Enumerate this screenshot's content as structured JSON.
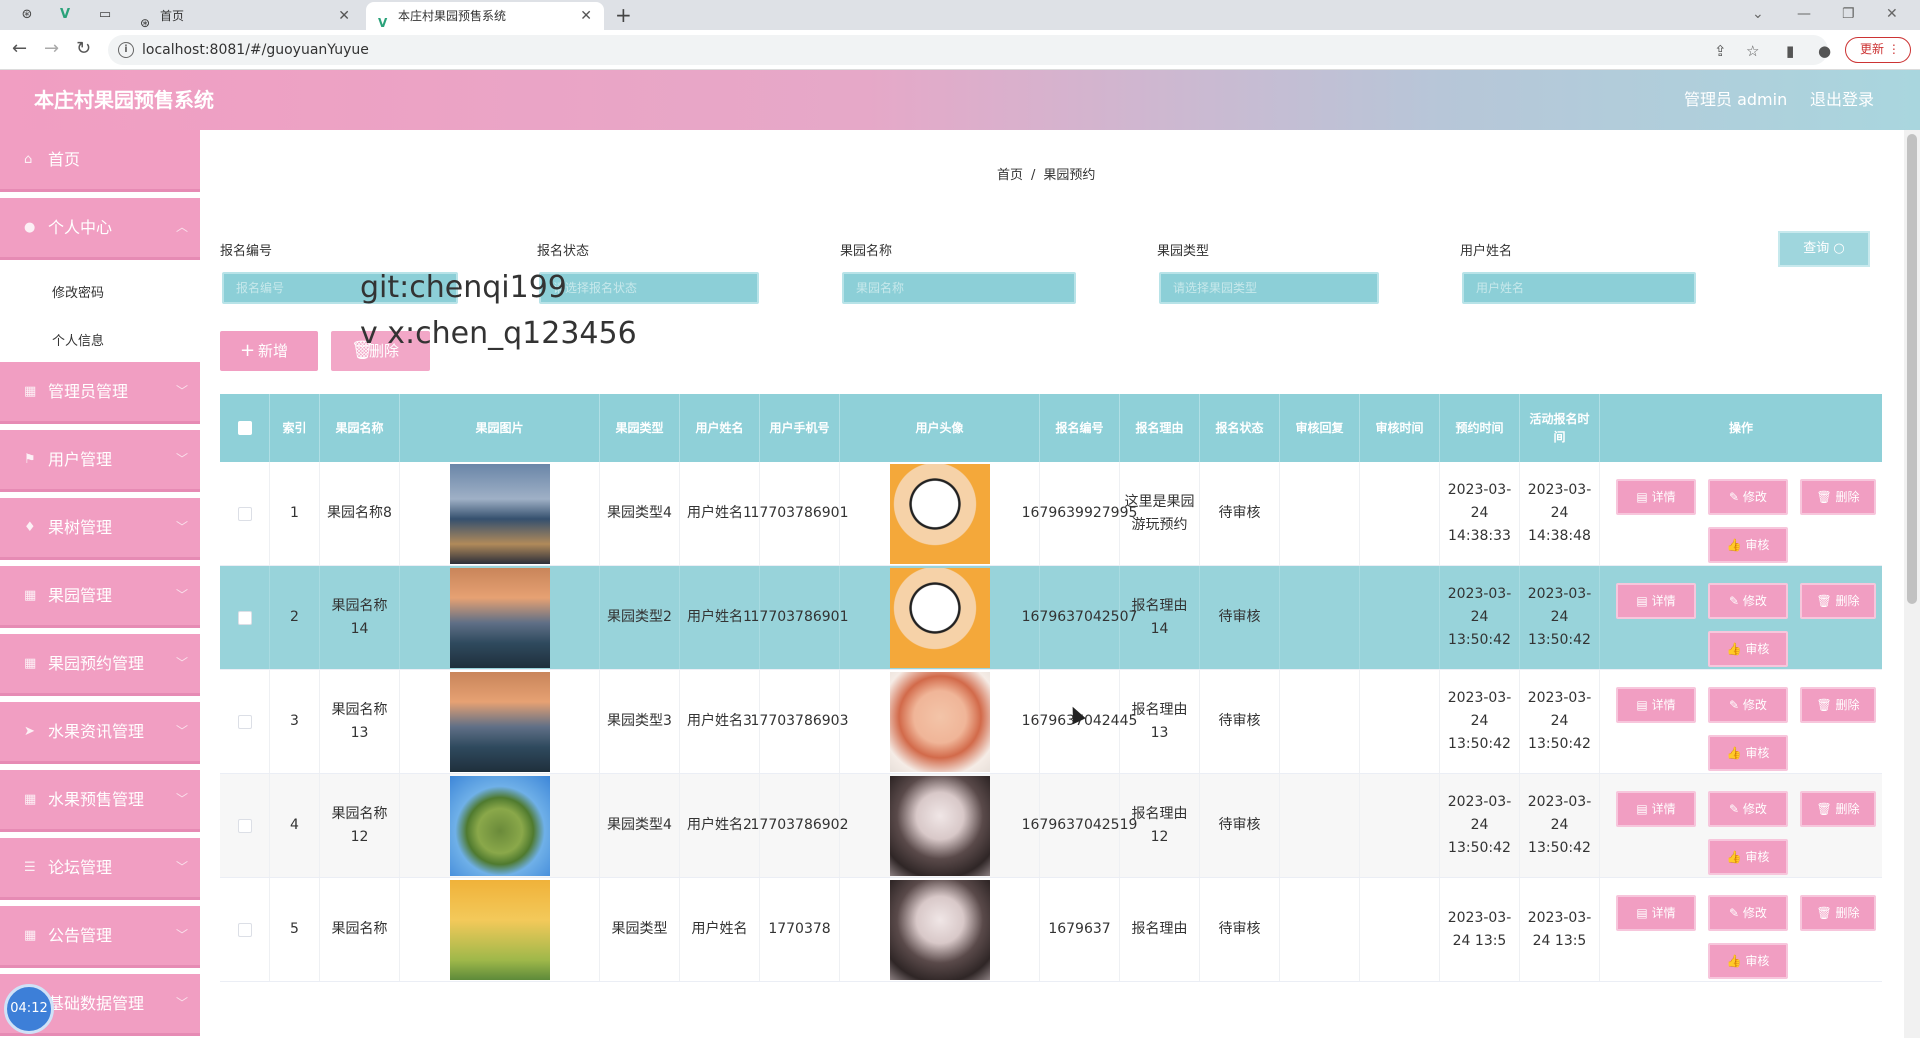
{
  "browser": {
    "tabs": [
      {
        "title": "首页",
        "active": false
      },
      {
        "title": "本庄村果园预售系统",
        "active": true
      }
    ],
    "url": "localhost:8081/#/guoyuanYuyue",
    "update_label": "更新"
  },
  "app": {
    "title": "本庄村果园预售系统",
    "admin_label": "管理员 admin",
    "logout_label": "退出登录"
  },
  "sidebar": {
    "items": [
      {
        "label": "首页",
        "icon": "home-icon"
      },
      {
        "label": "个人中心",
        "icon": "user-icon"
      },
      {
        "label": "修改密码",
        "sub": true
      },
      {
        "label": "个人信息",
        "sub": true
      },
      {
        "label": "管理员管理",
        "icon": "grid-icon"
      },
      {
        "label": "用户管理",
        "icon": "flag-icon"
      },
      {
        "label": "果树管理",
        "icon": "bulb-icon"
      },
      {
        "label": "果园管理",
        "icon": "grid-icon"
      },
      {
        "label": "果园预约管理",
        "icon": "grid-icon"
      },
      {
        "label": "水果资讯管理",
        "icon": "send-icon"
      },
      {
        "label": "水果预售管理",
        "icon": "grid-icon"
      },
      {
        "label": "论坛管理",
        "icon": "list-icon"
      },
      {
        "label": "公告管理",
        "icon": "grid-icon"
      },
      {
        "label": "基础数据管理",
        "icon": "grid-icon"
      }
    ]
  },
  "breadcrumb": [
    "首页",
    "/",
    "果园预约"
  ],
  "filters": [
    {
      "label": "报名编号",
      "placeholder": "报名编号"
    },
    {
      "label": "报名状态",
      "placeholder": "请选择报名状态"
    },
    {
      "label": "果园名称",
      "placeholder": "果园名称"
    },
    {
      "label": "果园类型",
      "placeholder": "请选择果园类型"
    },
    {
      "label": "用户姓名",
      "placeholder": "用户姓名"
    }
  ],
  "search_label": "查询",
  "add_label": "新增",
  "delete_label": "删除",
  "watermark": [
    "git:chenqi199",
    "v x:chen_q123456"
  ],
  "table": {
    "headers": [
      "索引",
      "果园名称",
      "果园图片",
      "果园类型",
      "用户姓名",
      "用户手机号",
      "用户头像",
      "报名编号",
      "报名理由",
      "报名状态",
      "审核回复",
      "审核时间",
      "预约时间",
      "活动报名时间",
      "操作"
    ],
    "rows": [
      {
        "idx": "1",
        "name": "果园名称8",
        "type": "果园类型4",
        "user": "用户姓名1",
        "phone": "17703786901",
        "no": "1679639927995",
        "reason": "这里是果园游玩预约",
        "status": "待审核",
        "reply": "",
        "audit_time": "",
        "book_time": "2023-03-24 14:38:33",
        "act_time": "2023-03-24 14:38:48",
        "img": "city",
        "avatar": "cartoon"
      },
      {
        "idx": "2",
        "name": "果园名称14",
        "type": "果园类型2",
        "user": "用户姓名1",
        "phone": "17703786901",
        "no": "1679637042507",
        "reason": "报名理由14",
        "status": "待审核",
        "reply": "",
        "audit_time": "",
        "book_time": "2023-03-24 13:50:42",
        "act_time": "2023-03-24 13:50:42",
        "img": "lake",
        "avatar": "cartoon"
      },
      {
        "idx": "3",
        "name": "果园名称13",
        "type": "果园类型3",
        "user": "用户姓名3",
        "phone": "17703786903",
        "no": "1679637042445",
        "reason": "报名理由13",
        "status": "待审核",
        "reply": "",
        "audit_time": "",
        "book_time": "2023-03-24 13:50:42",
        "act_time": "2023-03-24 13:50:42",
        "img": "lake",
        "avatar": "girl1"
      },
      {
        "idx": "4",
        "name": "果园名称12",
        "type": "果园类型4",
        "user": "用户姓名2",
        "phone": "17703786902",
        "no": "1679637042519",
        "reason": "报名理由12",
        "status": "待审核",
        "reply": "",
        "audit_time": "",
        "book_time": "2023-03-24 13:50:42",
        "act_time": "2023-03-24 13:50:42",
        "img": "planet",
        "avatar": "girl2"
      },
      {
        "idx": "5",
        "name": "果园名称",
        "type": "果园类型",
        "user": "用户姓名",
        "phone": "1770378",
        "no": "1679637",
        "reason": "报名理由",
        "status": "待审核",
        "reply": "",
        "audit_time": "",
        "book_time": "2023-03-24 13:5",
        "act_time": "2023-03-24 13:5",
        "img": "sunset",
        "avatar": "girl2"
      }
    ],
    "ops": {
      "detail": "详情",
      "edit": "修改",
      "delete": "删除",
      "audit": "审核"
    }
  },
  "timer": "04:12",
  "colors": {
    "pink": "#f19ec2",
    "teal": "#8fd0d8",
    "highlight_row": "#98d3da"
  }
}
